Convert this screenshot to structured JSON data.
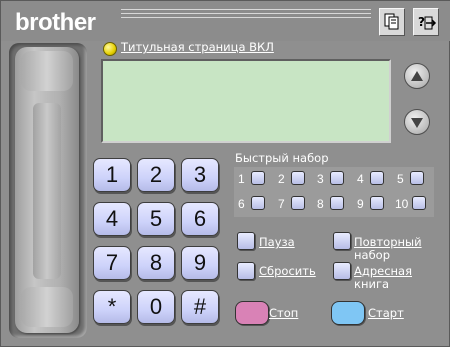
{
  "brand": {
    "logo_text": "brother"
  },
  "top_icons": [
    {
      "name": "document-icon"
    },
    {
      "name": "help-exit-icon"
    }
  ],
  "status": {
    "lamp_color": "#e6d000",
    "text": "Титульная страница ВКЛ"
  },
  "display": {
    "background": "#c8e5c4",
    "text": ""
  },
  "scroll": {
    "up_icon": "triangle-up-icon",
    "down_icon": "triangle-down-icon"
  },
  "keypad": [
    "1",
    "2",
    "3",
    "4",
    "5",
    "6",
    "7",
    "8",
    "9",
    "*",
    "0",
    "#"
  ],
  "speed_dial": {
    "label": "Быстрый набор",
    "keys": [
      "1",
      "2",
      "3",
      "4",
      "5",
      "6",
      "7",
      "8",
      "9",
      "10"
    ]
  },
  "functions": {
    "pause": "Пауза",
    "reset": "Сбросить",
    "redial_line1": "Повторный",
    "redial_line2": "набор",
    "addressbook_line1": "Адресная",
    "addressbook_line2": "книга"
  },
  "controls": {
    "stop": "Стоп",
    "start": "Старт",
    "stop_color": "#d982b6",
    "start_color": "#7fc6f4"
  }
}
